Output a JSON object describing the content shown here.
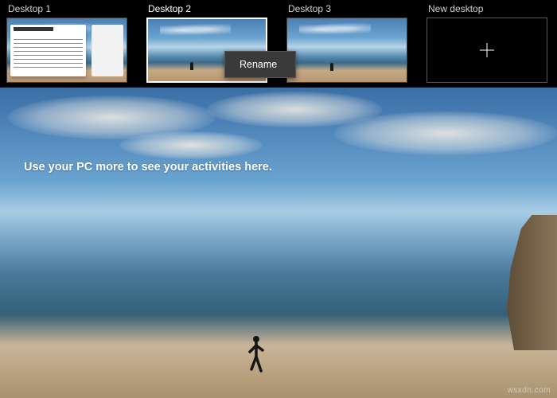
{
  "desktops": [
    {
      "label": "Desktop 1",
      "active": false,
      "has_window": true
    },
    {
      "label": "Desktop 2",
      "active": true,
      "has_window": false
    },
    {
      "label": "Desktop 3",
      "active": false,
      "has_window": false
    }
  ],
  "new_desktop": {
    "label": "New desktop"
  },
  "context_menu": {
    "rename": "Rename"
  },
  "activity_message": "Use your PC more to see your activities here.",
  "watermark": "wsxdn.com"
}
